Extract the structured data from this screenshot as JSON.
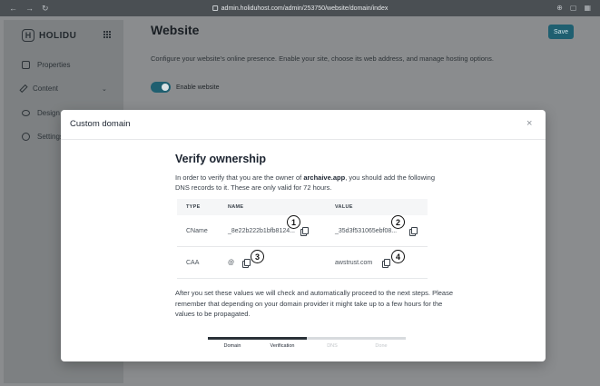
{
  "browser": {
    "nav_back": "←",
    "nav_forward": "→",
    "nav_reload": "↻",
    "url": "admin.holiduhost.com/admin/253750/website/domain/index"
  },
  "sidebar": {
    "logo_text": "HOLIDU",
    "items": [
      {
        "label": "Properties",
        "icon": "home-icon"
      },
      {
        "label": "Content",
        "icon": "pencil-icon",
        "has_chevron": true
      },
      {
        "label": "Design",
        "icon": "eye-icon"
      },
      {
        "label": "Settings",
        "icon": "gear-icon"
      }
    ]
  },
  "main": {
    "title": "Website",
    "save_label": "Save",
    "description": "Configure your website's online presence. Enable your site, choose its web address, and manage hosting options.",
    "toggle_label": "Enable website",
    "toggle_on": true
  },
  "modal": {
    "title": "Custom domain",
    "close_symbol": "×",
    "verify_title": "Verify ownership",
    "verify_text_before": "In order to verify that you are the owner of ",
    "verify_domain": "archaive.app",
    "verify_text_after": ", you should add the following DNS records to it. These are only valid for 72 hours.",
    "table": {
      "headers": {
        "type": "TYPE",
        "name": "NAME",
        "value": "VALUE"
      },
      "rows": [
        {
          "type": "CName",
          "name": "_8e22b222b1bfb8124...",
          "value": "_35d3f531065ebf08..."
        },
        {
          "type": "CAA",
          "name": "@",
          "value": "awstrust.com"
        }
      ]
    },
    "badges": [
      "1",
      "2",
      "3",
      "4"
    ],
    "after_text": "After you set these values we will check and automatically proceed to the next steps. Please remember that depending on your domain provider it might take up to a few hours for the values to be propagated.",
    "steps": [
      {
        "label": "Domain",
        "state": "done"
      },
      {
        "label": "Verification",
        "state": "active"
      },
      {
        "label": "DNS",
        "state": "pending"
      },
      {
        "label": "Done",
        "state": "pending"
      }
    ],
    "progress_fraction": 0.5
  },
  "colors": {
    "accent": "#1f5f70",
    "overlay_bg": "#8a8c8e",
    "step_active": "#1c2430",
    "step_pending": "#c3c7cb"
  }
}
